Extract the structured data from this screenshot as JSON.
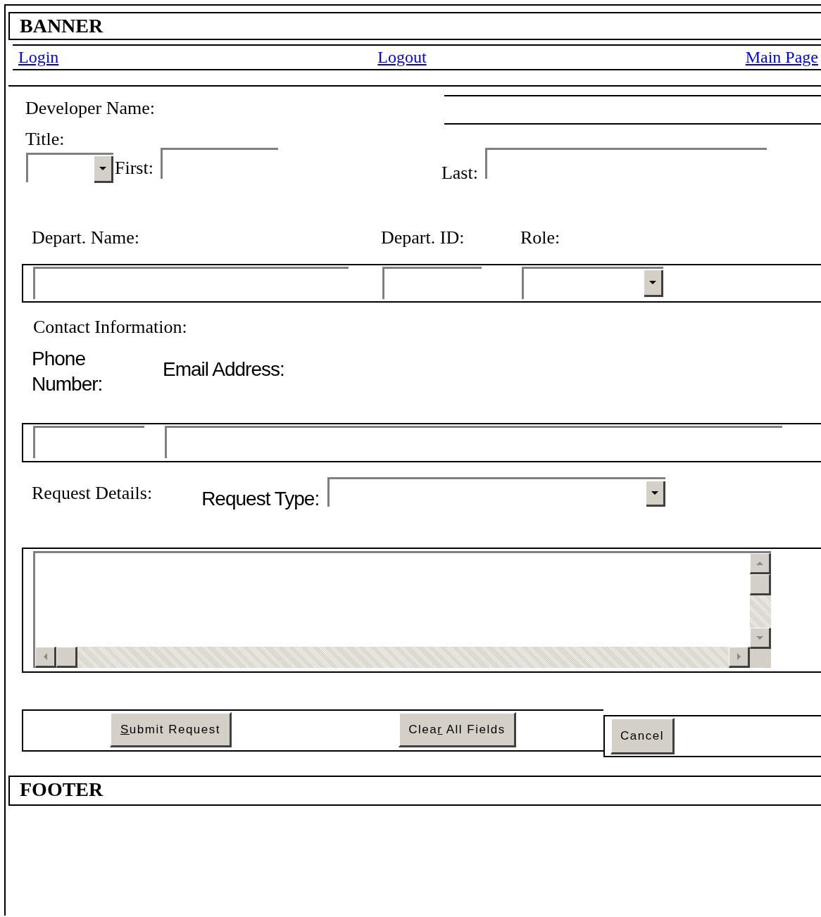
{
  "banner": {
    "title": "BANNER"
  },
  "nav": [
    {
      "label": "Login"
    },
    {
      "label": "Logout"
    },
    {
      "label": "Main Page"
    }
  ],
  "developer": {
    "heading": "Developer Name:",
    "title_label": "Title:",
    "first_label": "First:",
    "last_label": "Last:"
  },
  "department": {
    "name_label": "Depart. Name:",
    "id_label": "Depart. ID:",
    "role_label": "Role:"
  },
  "contact": {
    "heading": "Contact Information:",
    "phone_label": "Phone Number:",
    "email_label": "Email Address:"
  },
  "request": {
    "heading": "Request Details:",
    "type_label": "Request Type:"
  },
  "buttons": [
    {
      "kind": "submit",
      "key": "S",
      "after": "ubmit Request"
    },
    {
      "kind": "clear",
      "before": "Clea",
      "key": "r",
      "after": " All Fields"
    },
    {
      "kind": "cancel",
      "before": "Cancel"
    }
  ],
  "footer": {
    "title": "FOOTER"
  }
}
